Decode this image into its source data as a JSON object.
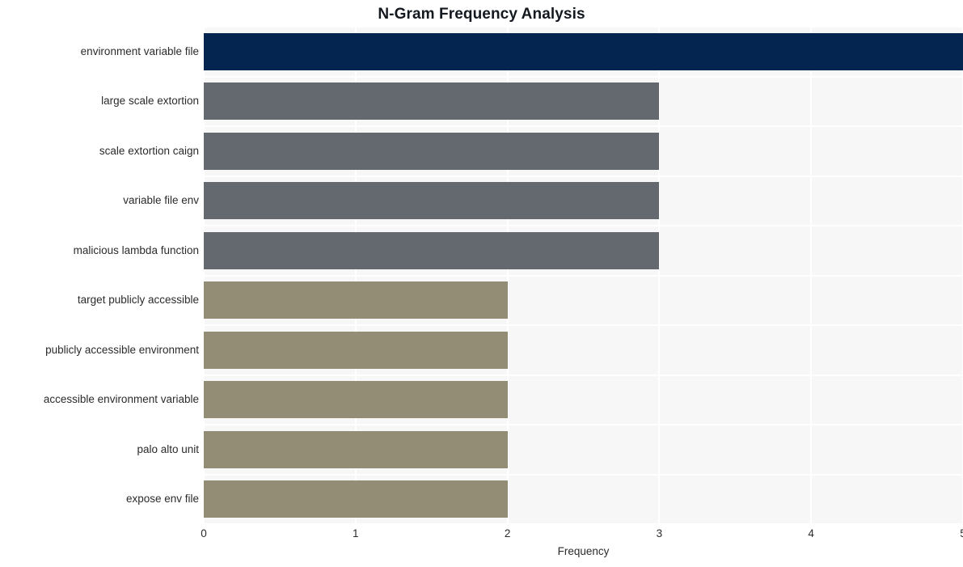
{
  "chart_data": {
    "type": "bar",
    "orientation": "horizontal",
    "title": "N-Gram Frequency Analysis",
    "xlabel": "Frequency",
    "ylabel": "",
    "categories": [
      "environment variable file",
      "large scale extortion",
      "scale extortion caign",
      "variable file env",
      "malicious lambda function",
      "target publicly accessible",
      "publicly accessible environment",
      "accessible environment variable",
      "palo alto unit",
      "expose env file"
    ],
    "values": [
      5,
      3,
      3,
      3,
      3,
      2,
      2,
      2,
      2,
      2
    ],
    "bar_colors": [
      "#042550",
      "#64686f",
      "#64686f",
      "#64686f",
      "#64686f",
      "#928d74",
      "#928d74",
      "#928d74",
      "#928d74",
      "#928d74"
    ],
    "xlim": [
      0,
      5
    ],
    "xticks": [
      0,
      1,
      2,
      3,
      4,
      5
    ],
    "xtick_labels": [
      "0",
      "1",
      "2",
      "3",
      "4",
      "5"
    ],
    "grid": true,
    "grid_color": "#ffffff",
    "plot_background": "#f7f7f8",
    "figure_background": "#ffffff",
    "legend": null,
    "title_color": "#14181f",
    "tick_label_color": "#2b2b2b"
  }
}
